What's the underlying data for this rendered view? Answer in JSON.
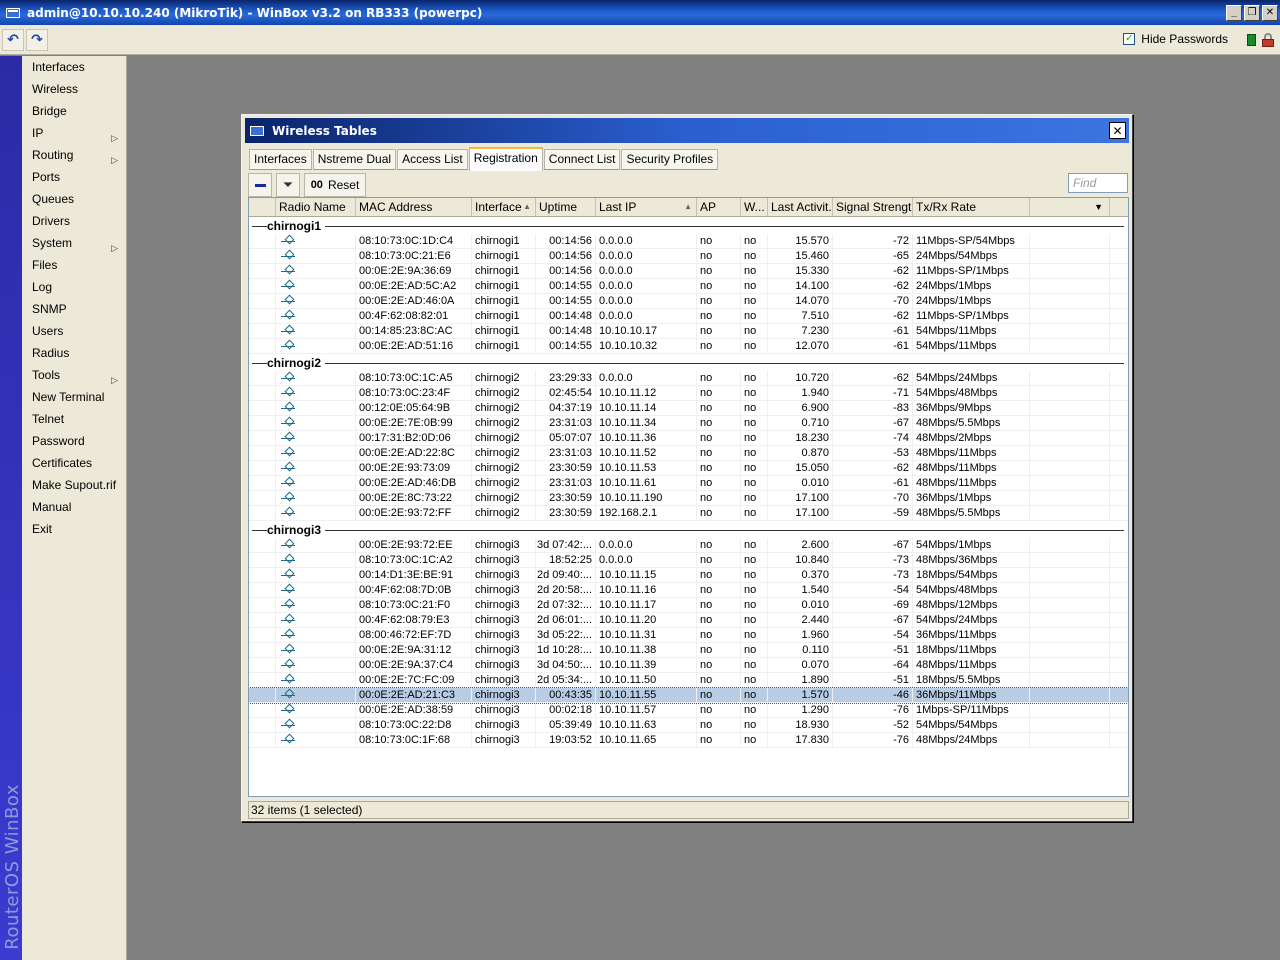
{
  "window": {
    "title": "admin@10.10.10.240 (MikroTik) - WinBox v3.2 on RB333 (powerpc)",
    "min_glyph": "_",
    "max_glyph": "❐",
    "close_glyph": "✕"
  },
  "toolbar": {
    "undo_icon": "↶",
    "redo_icon": "↷",
    "hide_passwords_label": "Hide Passwords",
    "hide_passwords_checked": true,
    "check_glyph": "✓"
  },
  "brand_vertical": "RouterOS WinBox",
  "sidebar": {
    "items": [
      {
        "label": "Interfaces",
        "submenu": false
      },
      {
        "label": "Wireless",
        "submenu": false
      },
      {
        "label": "Bridge",
        "submenu": false
      },
      {
        "label": "IP",
        "submenu": true
      },
      {
        "label": "Routing",
        "submenu": true
      },
      {
        "label": "Ports",
        "submenu": false
      },
      {
        "label": "Queues",
        "submenu": false
      },
      {
        "label": "Drivers",
        "submenu": false
      },
      {
        "label": "System",
        "submenu": true
      },
      {
        "label": "Files",
        "submenu": false
      },
      {
        "label": "Log",
        "submenu": false
      },
      {
        "label": "SNMP",
        "submenu": false
      },
      {
        "label": "Users",
        "submenu": false
      },
      {
        "label": "Radius",
        "submenu": false
      },
      {
        "label": "Tools",
        "submenu": true
      },
      {
        "label": "New Terminal",
        "submenu": false
      },
      {
        "label": "Telnet",
        "submenu": false
      },
      {
        "label": "Password",
        "submenu": false
      },
      {
        "label": "Certificates",
        "submenu": false
      },
      {
        "label": "Make Supout.rif",
        "submenu": false
      },
      {
        "label": "Manual",
        "submenu": false
      },
      {
        "label": "Exit",
        "submenu": false
      }
    ],
    "submenu_glyph": "▷"
  },
  "dialog": {
    "title": "Wireless Tables",
    "close_glyph": "✕",
    "tabs": [
      {
        "label": "Interfaces",
        "active": false
      },
      {
        "label": "Nstreme Dual",
        "active": false
      },
      {
        "label": "Access List",
        "active": false
      },
      {
        "label": "Registration",
        "active": true
      },
      {
        "label": "Connect List",
        "active": false
      },
      {
        "label": "Security Profiles",
        "active": false
      }
    ],
    "toolbar": {
      "filter_icon": "⏷",
      "reset_prefix": "00",
      "reset_label": "Reset",
      "find_placeholder": "Find"
    },
    "columns": [
      "",
      "Radio Name",
      "MAC Address",
      "Interface",
      "Uptime",
      "Last IP",
      "AP",
      "W...",
      "Last Activit...",
      "Signal Strengt...",
      "Tx/Rx Rate",
      ""
    ],
    "sort_glyph": "▲",
    "dropdown_glyph": "▼",
    "groups": [
      {
        "name": "chirnogi1",
        "rows": [
          [
            "",
            "08:10:73:0C:1D:C4",
            "chirnogi1",
            "00:14:56",
            "0.0.0.0",
            "no",
            "no",
            "15.570",
            "-72",
            "11Mbps-SP/54Mbps"
          ],
          [
            "",
            "08:10:73:0C:21:E6",
            "chirnogi1",
            "00:14:56",
            "0.0.0.0",
            "no",
            "no",
            "15.460",
            "-65",
            "24Mbps/54Mbps"
          ],
          [
            "",
            "00:0E:2E:9A:36:69",
            "chirnogi1",
            "00:14:56",
            "0.0.0.0",
            "no",
            "no",
            "15.330",
            "-62",
            "11Mbps-SP/1Mbps"
          ],
          [
            "",
            "00:0E:2E:AD:5C:A2",
            "chirnogi1",
            "00:14:55",
            "0.0.0.0",
            "no",
            "no",
            "14.100",
            "-62",
            "24Mbps/1Mbps"
          ],
          [
            "",
            "00:0E:2E:AD:46:0A",
            "chirnogi1",
            "00:14:55",
            "0.0.0.0",
            "no",
            "no",
            "14.070",
            "-70",
            "24Mbps/1Mbps"
          ],
          [
            "",
            "00:4F:62:08:82:01",
            "chirnogi1",
            "00:14:48",
            "0.0.0.0",
            "no",
            "no",
            "7.510",
            "-62",
            "11Mbps-SP/1Mbps"
          ],
          [
            "",
            "00:14:85:23:8C:AC",
            "chirnogi1",
            "00:14:48",
            "10.10.10.17",
            "no",
            "no",
            "7.230",
            "-61",
            "54Mbps/11Mbps"
          ],
          [
            "",
            "00:0E:2E:AD:51:16",
            "chirnogi1",
            "00:14:55",
            "10.10.10.32",
            "no",
            "no",
            "12.070",
            "-61",
            "54Mbps/11Mbps"
          ]
        ]
      },
      {
        "name": "chirnogi2",
        "rows": [
          [
            "",
            "08:10:73:0C:1C:A5",
            "chirnogi2",
            "23:29:33",
            "0.0.0.0",
            "no",
            "no",
            "10.720",
            "-62",
            "54Mbps/24Mbps"
          ],
          [
            "",
            "08:10:73:0C:23:4F",
            "chirnogi2",
            "02:45:54",
            "10.10.11.12",
            "no",
            "no",
            "1.940",
            "-71",
            "54Mbps/48Mbps"
          ],
          [
            "",
            "00:12:0E:05:64:9B",
            "chirnogi2",
            "04:37:19",
            "10.10.11.14",
            "no",
            "no",
            "6.900",
            "-83",
            "36Mbps/9Mbps"
          ],
          [
            "",
            "00:0E:2E:7E:0B:99",
            "chirnogi2",
            "23:31:03",
            "10.10.11.34",
            "no",
            "no",
            "0.710",
            "-67",
            "48Mbps/5.5Mbps"
          ],
          [
            "",
            "00:17:31:B2:0D:06",
            "chirnogi2",
            "05:07:07",
            "10.10.11.36",
            "no",
            "no",
            "18.230",
            "-74",
            "48Mbps/2Mbps"
          ],
          [
            "",
            "00:0E:2E:AD:22:8C",
            "chirnogi2",
            "23:31:03",
            "10.10.11.52",
            "no",
            "no",
            "0.870",
            "-53",
            "48Mbps/11Mbps"
          ],
          [
            "",
            "00:0E:2E:93:73:09",
            "chirnogi2",
            "23:30:59",
            "10.10.11.53",
            "no",
            "no",
            "15.050",
            "-62",
            "48Mbps/11Mbps"
          ],
          [
            "",
            "00:0E:2E:AD:46:DB",
            "chirnogi2",
            "23:31:03",
            "10.10.11.61",
            "no",
            "no",
            "0.010",
            "-61",
            "48Mbps/11Mbps"
          ],
          [
            "",
            "00:0E:2E:8C:73:22",
            "chirnogi2",
            "23:30:59",
            "10.10.11.190",
            "no",
            "no",
            "17.100",
            "-70",
            "36Mbps/1Mbps"
          ],
          [
            "",
            "00:0E:2E:93:72:FF",
            "chirnogi2",
            "23:30:59",
            "192.168.2.1",
            "no",
            "no",
            "17.100",
            "-59",
            "48Mbps/5.5Mbps"
          ]
        ]
      },
      {
        "name": "chirnogi3",
        "rows": [
          [
            "",
            "00:0E:2E:93:72:EE",
            "chirnogi3",
            "3d 07:42:...",
            "0.0.0.0",
            "no",
            "no",
            "2.600",
            "-67",
            "54Mbps/1Mbps"
          ],
          [
            "",
            "08:10:73:0C:1C:A2",
            "chirnogi3",
            "18:52:25",
            "0.0.0.0",
            "no",
            "no",
            "10.840",
            "-73",
            "48Mbps/36Mbps"
          ],
          [
            "",
            "00:14:D1:3E:BE:91",
            "chirnogi3",
            "2d 09:40:...",
            "10.10.11.15",
            "no",
            "no",
            "0.370",
            "-73",
            "18Mbps/54Mbps"
          ],
          [
            "",
            "00:4F:62:08:7D:0B",
            "chirnogi3",
            "2d 20:58:...",
            "10.10.11.16",
            "no",
            "no",
            "1.540",
            "-54",
            "54Mbps/48Mbps"
          ],
          [
            "",
            "08:10:73:0C:21:F0",
            "chirnogi3",
            "2d 07:32:...",
            "10.10.11.17",
            "no",
            "no",
            "0.010",
            "-69",
            "48Mbps/12Mbps"
          ],
          [
            "",
            "00:4F:62:08:79:E3",
            "chirnogi3",
            "2d 06:01:...",
            "10.10.11.20",
            "no",
            "no",
            "2.440",
            "-67",
            "54Mbps/24Mbps"
          ],
          [
            "",
            "08:00:46:72:EF:7D",
            "chirnogi3",
            "3d 05:22:...",
            "10.10.11.31",
            "no",
            "no",
            "1.960",
            "-54",
            "36Mbps/11Mbps"
          ],
          [
            "",
            "00:0E:2E:9A:31:12",
            "chirnogi3",
            "1d 10:28:...",
            "10.10.11.38",
            "no",
            "no",
            "0.110",
            "-51",
            "18Mbps/11Mbps"
          ],
          [
            "",
            "00:0E:2E:9A:37:C4",
            "chirnogi3",
            "3d 04:50:...",
            "10.10.11.39",
            "no",
            "no",
            "0.070",
            "-64",
            "48Mbps/11Mbps"
          ],
          [
            "",
            "00:0E:2E:7C:FC:09",
            "chirnogi3",
            "2d 05:34:...",
            "10.10.11.50",
            "no",
            "no",
            "1.890",
            "-51",
            "18Mbps/5.5Mbps"
          ],
          [
            "",
            "00:0E:2E:AD:21:C3",
            "chirnogi3",
            "00:43:35",
            "10.10.11.55",
            "no",
            "no",
            "1.570",
            "-46",
            "36Mbps/11Mbps"
          ],
          [
            "",
            "00:0E:2E:AD:38:59",
            "chirnogi3",
            "00:02:18",
            "10.10.11.57",
            "no",
            "no",
            "1.290",
            "-76",
            "1Mbps-SP/11Mbps"
          ],
          [
            "",
            "08:10:73:0C:22:D8",
            "chirnogi3",
            "05:39:49",
            "10.10.11.63",
            "no",
            "no",
            "18.930",
            "-52",
            "54Mbps/54Mbps"
          ],
          [
            "",
            "08:10:73:0C:1F:68",
            "chirnogi3",
            "19:03:52",
            "10.10.11.65",
            "no",
            "no",
            "17.830",
            "-76",
            "48Mbps/24Mbps"
          ]
        ]
      }
    ],
    "selected": {
      "group": 2,
      "row": 10
    },
    "status": "32 items (1 selected)"
  },
  "colors": {
    "title_blue": "#0a246a",
    "selection": "#b8cce4",
    "desktop": "#808080",
    "brand_band": "#2b2ba6"
  }
}
